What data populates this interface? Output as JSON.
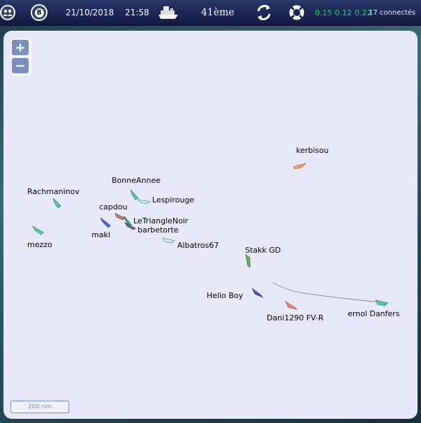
{
  "topbar": {
    "date": "21/10/2018",
    "time": "21:58",
    "rank": "41ème",
    "compass_badge": "8",
    "stats": [
      "0.15",
      "0.12",
      "0.22"
    ],
    "connected": "17 connectés",
    "colors": {
      "stats": "#1fd45a",
      "bar": "#1a2452"
    }
  },
  "map": {
    "zoom_in": "+",
    "zoom_out": "−",
    "scale": "200 nm",
    "boats": [
      {
        "name": "kerbisou",
        "color": "#f0a860"
      },
      {
        "name": "BonneAnnee",
        "color": "#5ac8a0"
      },
      {
        "name": "Rachmaninov",
        "color": "#5ac8a0"
      },
      {
        "name": "Lespirouge",
        "color": "#d0f0f0"
      },
      {
        "name": "capdou",
        "color": "#c08070"
      },
      {
        "name": "LeTriangleNoir",
        "color": "#40a890"
      },
      {
        "name": "barbetorte",
        "color": "#607080"
      },
      {
        "name": "maki",
        "color": "#5060e0"
      },
      {
        "name": "mezzo",
        "color": "#5ac8a0"
      },
      {
        "name": "Albatros67",
        "color": "#d0f0f0"
      },
      {
        "name": "Stakk GD",
        "color": "#70b050"
      },
      {
        "name": "Hello Boy",
        "color": "#5050d0"
      },
      {
        "name": "Dani1290 FV-R",
        "color": "#f08070"
      },
      {
        "name": "ernol Danfers",
        "color": "#5ac8a0"
      }
    ]
  }
}
